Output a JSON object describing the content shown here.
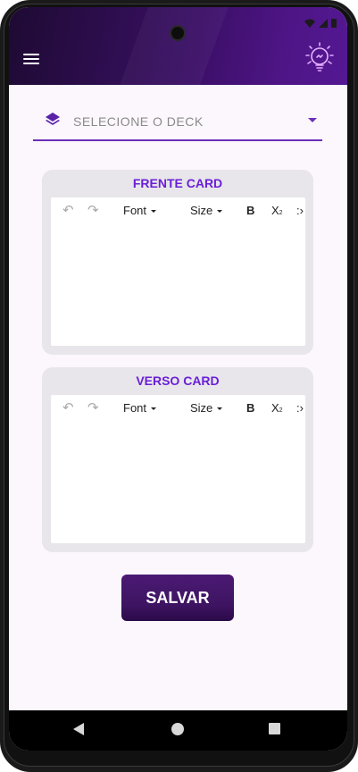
{
  "header": {
    "menu_icon": "hamburger-menu-icon",
    "logo_icon": "lightbulb-icon"
  },
  "deck_select": {
    "placeholder": "SELECIONE O DECK",
    "icon": "layers-icon"
  },
  "front_card": {
    "title": "FRENTE CARD",
    "toolbar": {
      "undo_icon": "undo-icon",
      "redo_icon": "redo-icon",
      "font_label": "Font",
      "size_label": "Size",
      "bold_label": "B",
      "subscript_label": "X",
      "subscript_mark": "2",
      "more_label": ":›"
    },
    "content": ""
  },
  "back_card": {
    "title": "VERSO CARD",
    "toolbar": {
      "undo_icon": "undo-icon",
      "redo_icon": "redo-icon",
      "font_label": "Font",
      "size_label": "Size",
      "bold_label": "B",
      "subscript_label": "X",
      "subscript_mark": "2",
      "more_label": ":›"
    },
    "content": ""
  },
  "save_button": {
    "label": "SALVAR"
  },
  "colors": {
    "accent": "#6a1fd8",
    "header_dark": "#1e0a33",
    "header_light": "#541893",
    "button": "#3e1462",
    "screen_bg": "#fcf7fd",
    "card_bg": "#e8e6ea"
  }
}
